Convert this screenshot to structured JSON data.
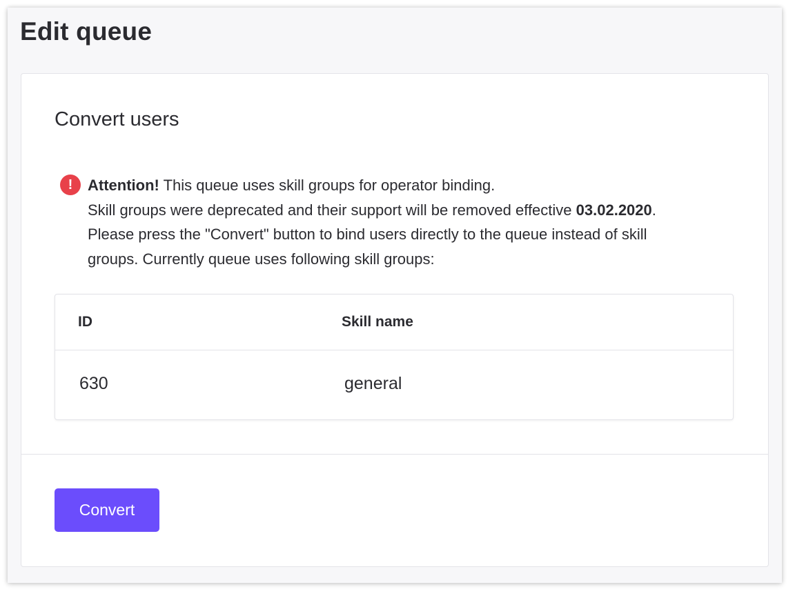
{
  "page": {
    "title": "Edit queue"
  },
  "section": {
    "title": "Convert users"
  },
  "alert": {
    "icon": "exclamation-circle-icon",
    "icon_glyph": "!",
    "icon_color": "#e8414a",
    "strong": "Attention!",
    "line1_rest": " This queue uses skill groups for operator binding.",
    "line2_prefix": "Skill groups were deprecated and their support will be removed effective ",
    "line2_date": "03.02.2020",
    "line2_suffix": ".",
    "line3": "Please press the \"Convert\" button to bind users directly to the queue instead of skill",
    "line4": "groups. Currently queue uses following skill groups:"
  },
  "table": {
    "columns": [
      "ID",
      "Skill name"
    ],
    "rows": [
      {
        "id": "630",
        "skill_name": "general"
      }
    ]
  },
  "actions": {
    "convert_label": "Convert",
    "accent_color": "#6b4dfc"
  }
}
